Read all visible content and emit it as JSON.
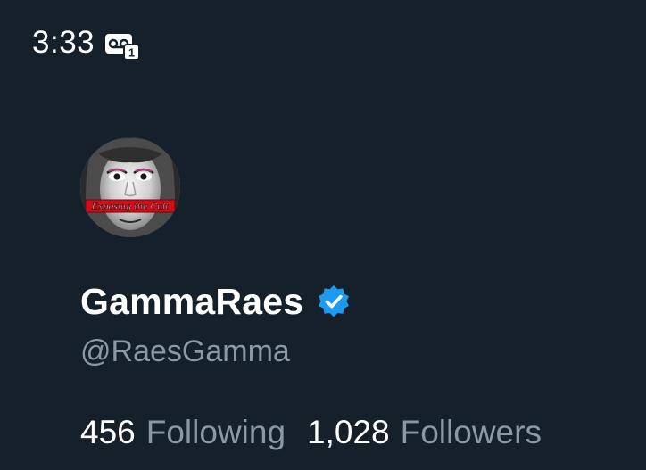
{
  "status_bar": {
    "time": "3:33",
    "voicemail_badge": "1"
  },
  "profile": {
    "avatar_caption": "Exposing the Cult",
    "display_name": "GammaRaes",
    "handle": "@RaesGamma",
    "verified": true,
    "following": {
      "count": "456",
      "label": "Following"
    },
    "followers": {
      "count": "1,028",
      "label": "Followers"
    }
  },
  "colors": {
    "background": "#15202b",
    "primary_text": "#ffffff",
    "secondary_text": "#8b98a5",
    "verified_badge": "#1d9bf0",
    "avatar_banner": "#d10f1a"
  }
}
